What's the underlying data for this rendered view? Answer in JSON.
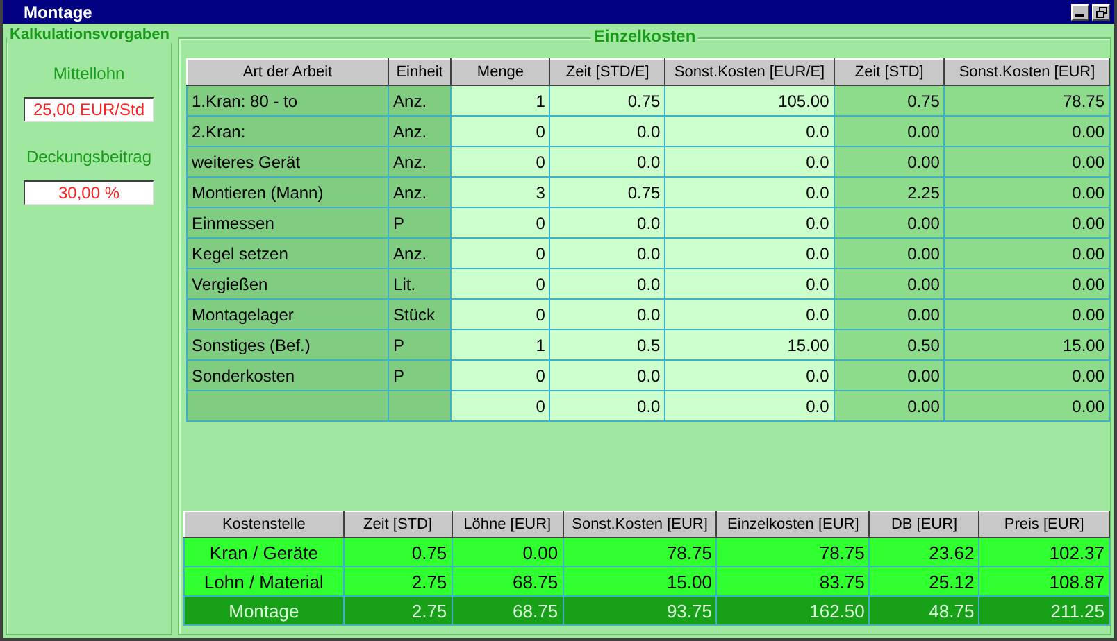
{
  "window": {
    "title": "Montage"
  },
  "settings": {
    "title": "Kalkulationsvorgaben",
    "fields": [
      {
        "label": "Mittellohn",
        "value": "25,00 EUR/Std"
      },
      {
        "label": "Deckungsbeitrag",
        "value": "30,00 %"
      }
    ]
  },
  "items": {
    "title": "Einzelkosten",
    "columns": [
      "Art der Arbeit",
      "Einheit",
      "Menge",
      "Zeit [STD/E]",
      "Sonst.Kosten [EUR/E]",
      "Zeit [STD]",
      "Sonst.Kosten [EUR]"
    ],
    "rows": [
      [
        "1.Kran: 80 - to",
        "Anz.",
        "1",
        "0.75",
        "105.00",
        "0.75",
        "78.75"
      ],
      [
        "2.Kran:",
        "Anz.",
        "0",
        "0.0",
        "0.0",
        "0.00",
        "0.00"
      ],
      [
        "weiteres Gerät",
        "Anz.",
        "0",
        "0.0",
        "0.0",
        "0.00",
        "0.00"
      ],
      [
        "Montieren (Mann)",
        "Anz.",
        "3",
        "0.75",
        "0.0",
        "2.25",
        "0.00"
      ],
      [
        "Einmessen",
        "P",
        "0",
        "0.0",
        "0.0",
        "0.00",
        "0.00"
      ],
      [
        "Kegel setzen",
        "Anz.",
        "0",
        "0.0",
        "0.0",
        "0.00",
        "0.00"
      ],
      [
        "Vergießen",
        "Lit.",
        "0",
        "0.0",
        "0.0",
        "0.00",
        "0.00"
      ],
      [
        "Montagelager",
        "Stück",
        "0",
        "0.0",
        "0.0",
        "0.00",
        "0.00"
      ],
      [
        "Sonstiges (Bef.)",
        "P",
        "1",
        "0.5",
        "15.00",
        "0.50",
        "15.00"
      ],
      [
        "Sonderkosten",
        "P",
        "0",
        "0.0",
        "0.0",
        "0.00",
        "0.00"
      ],
      [
        "",
        "",
        "0",
        "0.0",
        "0.0",
        "0.00",
        "0.00"
      ]
    ]
  },
  "summary": {
    "columns": [
      "Kostenstelle",
      "Zeit [STD]",
      "Löhne [EUR]",
      "Sonst.Kosten [EUR]",
      "Einzelkosten [EUR]",
      "DB [EUR]",
      "Preis [EUR]"
    ],
    "rows": [
      {
        "kind": "subtotal",
        "cells": [
          "Kran / Geräte",
          "0.75",
          "0.00",
          "78.75",
          "78.75",
          "23.62",
          "102.37"
        ]
      },
      {
        "kind": "subtotal",
        "cells": [
          "Lohn / Material",
          "2.75",
          "68.75",
          "15.00",
          "83.75",
          "25.12",
          "108.87"
        ]
      },
      {
        "kind": "total",
        "cells": [
          "Montage",
          "2.75",
          "68.75",
          "93.75",
          "162.50",
          "48.75",
          "211.25"
        ]
      }
    ]
  }
}
